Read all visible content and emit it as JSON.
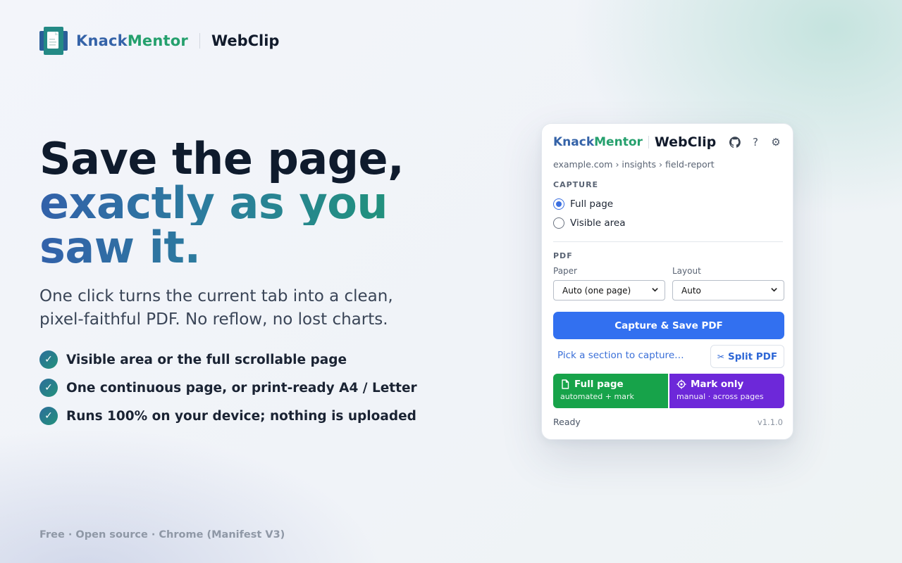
{
  "brand": {
    "name_part1": "Knack",
    "name_part2": "Mentor",
    "product": "WebClip",
    "logo_icon": "document-logo-icon"
  },
  "hero": {
    "line1": "Save the page,",
    "line2": "exactly as you",
    "line3": "saw it.",
    "subtitle": "One click turns the current tab into a clean, pixel-faithful PDF. No reflow, no lost charts."
  },
  "features": [
    {
      "text": "Visible area or the full scrollable page",
      "icon": "check-icon"
    },
    {
      "text": "One continuous page, or print-ready A4 / Letter",
      "icon": "check-icon"
    },
    {
      "text": "Runs 100% on your device; nothing is uploaded",
      "icon": "check-icon"
    }
  ],
  "footer": "Free · Open source · Chrome (Manifest V3)",
  "popup": {
    "brand_part1": "Knack",
    "brand_part2": "Mentor",
    "product": "WebClip",
    "icons": [
      "github-icon",
      "help-icon",
      "gear-icon"
    ],
    "help_glyph": "?",
    "gear_glyph": "⚙",
    "breadcrumb": "example.com › insights › field-report",
    "capture": {
      "label": "CAPTURE",
      "options": [
        {
          "label": "Full page",
          "selected": true
        },
        {
          "label": "Visible area",
          "selected": false
        }
      ]
    },
    "pdf": {
      "label": "PDF",
      "paper_label": "Paper",
      "paper_value": "Auto (one page)",
      "layout_label": "Layout",
      "layout_value": "Auto"
    },
    "primary_button": "Capture & Save PDF",
    "pick_link": "Pick a section to capture…",
    "split_button": "Split PDF",
    "split_glyph": "✂",
    "mode_full": {
      "title": "Full page",
      "subtitle": "automated + mark"
    },
    "mode_mark": {
      "title": "Mark only",
      "subtitle": "manual · across pages"
    },
    "status": "Ready",
    "version": "v1.1.0"
  },
  "colors": {
    "brand_blue": "#3563a8",
    "brand_green": "#25a06d",
    "primary": "#3270f0",
    "mode_green": "#17a34a",
    "mode_purple": "#6d28d9"
  }
}
